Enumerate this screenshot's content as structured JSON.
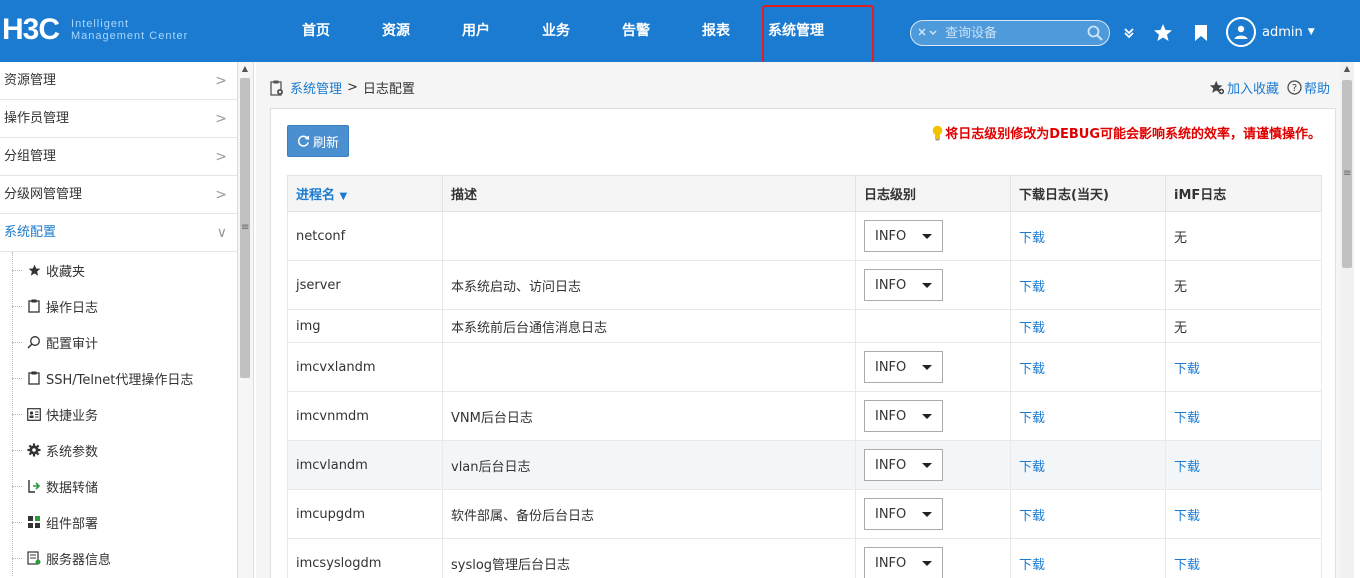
{
  "header": {
    "logo_main": "H3C",
    "logo_sub_line1": "Intelligent",
    "logo_sub_line2": "Management Center",
    "nav": [
      "首页",
      "资源",
      "用户",
      "业务",
      "告警",
      "报表",
      "系统管理"
    ],
    "search_placeholder": "查询设备",
    "username": "admin"
  },
  "sidebar": {
    "menus": [
      {
        "label": "资源管理",
        "chevron": ">"
      },
      {
        "label": "操作员管理",
        "chevron": ">"
      },
      {
        "label": "分组管理",
        "chevron": ">"
      },
      {
        "label": "分级网管管理",
        "chevron": ">"
      },
      {
        "label": "系统配置",
        "chevron": "∨"
      }
    ],
    "subitems": [
      {
        "label": "收藏夹",
        "icon": "star-icon"
      },
      {
        "label": "操作日志",
        "icon": "clipboard-icon"
      },
      {
        "label": "配置审计",
        "icon": "search-audit-icon"
      },
      {
        "label": "SSH/Telnet代理操作日志",
        "icon": "clipboard-icon"
      },
      {
        "label": "快捷业务",
        "icon": "contact-card-icon"
      },
      {
        "label": "系统参数",
        "icon": "gear-icon"
      },
      {
        "label": "数据转储",
        "icon": "data-dump-icon"
      },
      {
        "label": "组件部署",
        "icon": "component-icon"
      },
      {
        "label": "服务器信息",
        "icon": "server-info-icon"
      }
    ]
  },
  "breadcrumb": {
    "parent": "系统管理",
    "sep": ">",
    "current": "日志配置"
  },
  "actions": {
    "favorite": "加入收藏",
    "help": "帮助"
  },
  "toolbar": {
    "refresh": "刷新"
  },
  "warning": "将日志级别修改为DEBUG可能会影响系统的效率，请谨慎操作。",
  "table": {
    "headers": [
      "进程名",
      "描述",
      "日志级别",
      "下载日志(当天)",
      "iMF日志"
    ],
    "rows": [
      {
        "name": "netconf",
        "desc": "",
        "level": "INFO",
        "download": "下载",
        "imf": "无",
        "imf_link": false
      },
      {
        "name": "jserver",
        "desc": "本系统启动、访问日志",
        "level": "INFO",
        "download": "下载",
        "imf": "无",
        "imf_link": false
      },
      {
        "name": "img",
        "desc": "本系统前后台通信消息日志",
        "level": "",
        "download": "下载",
        "imf": "无",
        "imf_link": false
      },
      {
        "name": "imcvxlandm",
        "desc": "",
        "level": "INFO",
        "download": "下载",
        "imf": "下载",
        "imf_link": true
      },
      {
        "name": "imcvnmdm",
        "desc": "VNM后台日志",
        "level": "INFO",
        "download": "下载",
        "imf": "下载",
        "imf_link": true
      },
      {
        "name": "imcvlandm",
        "desc": "vlan后台日志",
        "level": "INFO",
        "download": "下载",
        "imf": "下载",
        "imf_link": true
      },
      {
        "name": "imcupgdm",
        "desc": "软件部属、备份后台日志",
        "level": "INFO",
        "download": "下载",
        "imf": "下载",
        "imf_link": true
      },
      {
        "name": "imcsyslogdm",
        "desc": "syslog管理后台日志",
        "level": "INFO",
        "download": "下载",
        "imf": "下载",
        "imf_link": true
      }
    ]
  }
}
